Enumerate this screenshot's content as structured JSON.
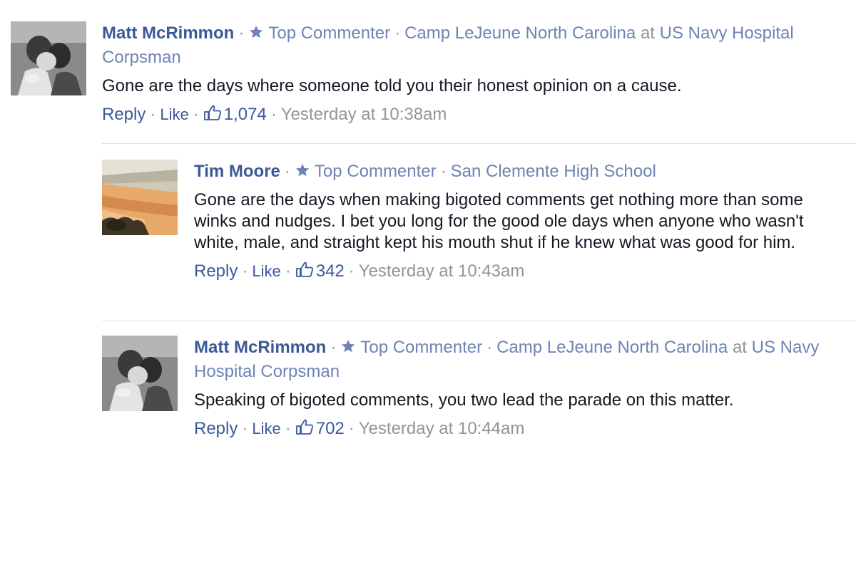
{
  "comments": [
    {
      "author": "Matt McRimmon",
      "badge": "Top Commenter",
      "affiliation": "Camp LeJeune North Carolina",
      "at_word": "at",
      "workplace": "US Navy Hospital Corpsman",
      "text": "Gone are the days where someone told you their honest opinion on a cause.",
      "reply_label": "Reply",
      "like_label": "Like",
      "likes": "1,074",
      "timestamp": "Yesterday at 10:38am",
      "avatar_icon": "couple-photo-icon"
    },
    {
      "author": "Tim Moore",
      "badge": "Top Commenter",
      "affiliation": "San Clemente High School",
      "text": "Gone are the days when making bigoted comments get nothing more than some winks and nudges. I bet you long for the good ole days when anyone who wasn't white, male, and straight kept his mouth shut if he knew what was good for him.",
      "reply_label": "Reply",
      "like_label": "Like",
      "likes": "342",
      "timestamp": "Yesterday at 10:43am",
      "avatar_icon": "beach-photo-icon"
    },
    {
      "author": "Matt McRimmon",
      "badge": "Top Commenter",
      "affiliation": "Camp LeJeune North Carolina",
      "at_word": "at",
      "workplace": "US Navy Hospital Corpsman",
      "text": "Speaking of bigoted comments, you two lead the parade on this matter.",
      "reply_label": "Reply",
      "like_label": "Like",
      "likes": "702",
      "timestamp": "Yesterday at 10:44am",
      "avatar_icon": "couple-photo-icon"
    }
  ],
  "separator": "·",
  "colors": {
    "name": "#3b5998",
    "meta_link": "#6d84b4",
    "muted": "#90949c",
    "text": "#141823",
    "divider": "#dcdee3"
  }
}
